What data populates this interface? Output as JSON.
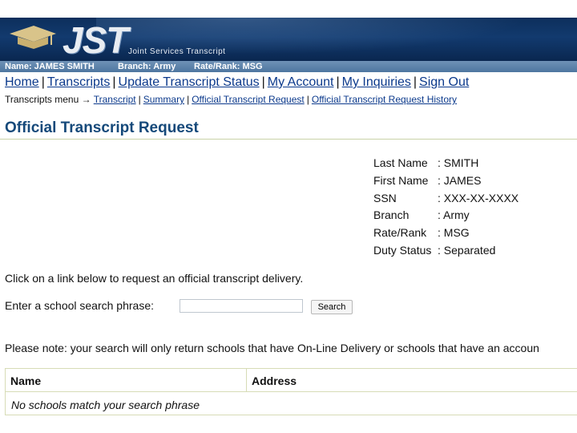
{
  "banner": {
    "logo_text": "JST",
    "logo_subtitle": "Joint Services Transcript"
  },
  "user_info": {
    "name": "Name: JAMES SMITH",
    "branch": "Branch: Army",
    "rate_rank": "Rate/Rank: MSG"
  },
  "nav": {
    "items": [
      "Home",
      "Transcripts",
      "Update Transcript Status",
      "My Account",
      "My Inquiries",
      "Sign Out"
    ],
    "separator": "|"
  },
  "submenu": {
    "prefix": "Transcripts menu →",
    "items": [
      "Transcript",
      "Summary",
      "Official Transcript Request",
      "Official Transcript Request History"
    ],
    "separator": "|"
  },
  "page_title": "Official Transcript Request",
  "details": [
    {
      "label": "Last Name",
      "value": ": SMITH"
    },
    {
      "label": "First Name",
      "value": ": JAMES"
    },
    {
      "label": "SSN",
      "value": ": XXX-XX-XXXX"
    },
    {
      "label": "Branch",
      "value": ": Army"
    },
    {
      "label": "Rate/Rank",
      "value": ": MSG"
    },
    {
      "label": "Duty Status",
      "value": ": Separated"
    }
  ],
  "instructions": "Click on a link below to request an official transcript delivery.",
  "search": {
    "label": "Enter a school search phrase:",
    "value": "",
    "placeholder": "",
    "button_label": "Search"
  },
  "note": "Please note: your search will only return schools that have On-Line Delivery or schools that have an accoun",
  "results_table": {
    "headers": [
      "Name",
      "Address"
    ],
    "empty_message": "No schools match your search phrase"
  },
  "colors": {
    "banner": "#123a6e",
    "info_bar": "#5b80a8",
    "link": "#0c3a8c",
    "heading": "#15497a",
    "table_border": "#d7dcb6"
  }
}
